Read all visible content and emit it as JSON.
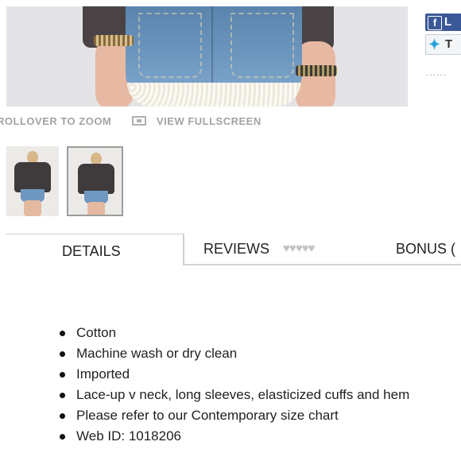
{
  "product_view": {
    "zoom_label": "ROLLOVER TO ZOOM",
    "fullscreen_label": "VIEW FULLSCREEN",
    "fullscreen_icon": "fullscreen-icon"
  },
  "social": {
    "facebook_label": "L",
    "facebook_icon": "facebook-icon",
    "twitter_label": "T",
    "twitter_icon": "twitter-icon",
    "more_dots": "......"
  },
  "thumbnails": [
    {
      "label": "front view",
      "selected": false
    },
    {
      "label": "back view",
      "selected": true
    }
  ],
  "tabs": {
    "details": "DETAILS",
    "reviews": "REVIEWS",
    "bonus": "BONUS (",
    "review_hearts": "♥♥♥♥♥"
  },
  "details": {
    "items": [
      "Cotton",
      "Machine wash or dry clean",
      "Imported",
      "Lace-up v neck, long sleeves, elasticized cuffs and hem",
      "Please refer to our Contemporary size chart",
      "Web ID: 1018206"
    ]
  },
  "colors": {
    "facebook": "#3b5998",
    "twitter": "#2ba3e0",
    "muted_text": "#a3a3a3",
    "hearts": "#c3c3c3"
  }
}
